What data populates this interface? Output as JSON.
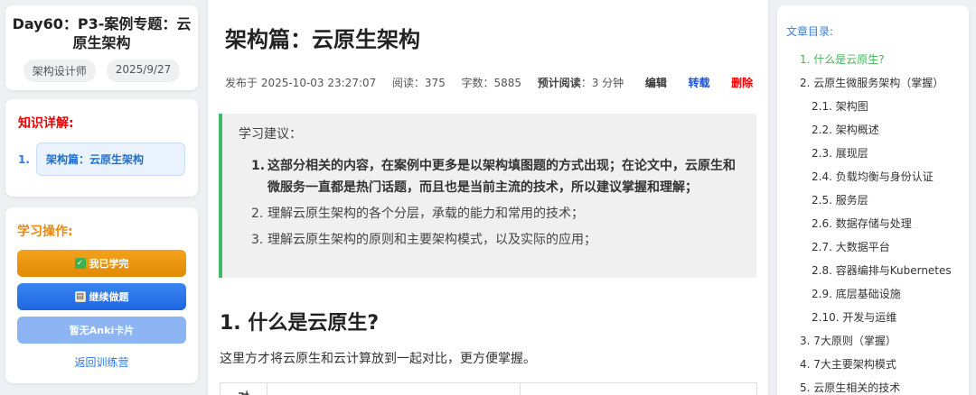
{
  "course": {
    "title": "Day60：P3-案例专题：云原生架构",
    "tags": [
      "架构设计师",
      "2025/9/27"
    ]
  },
  "knowledge": {
    "label": "知识详解:",
    "items": [
      {
        "num": "1.",
        "label": "架构篇：云原生架构"
      }
    ]
  },
  "study": {
    "label": "学习操作:",
    "done_button": "我已学完",
    "done_icon": "check-box-icon",
    "continue_button": "继续做题",
    "continue_icon": "clipboard-icon",
    "anki_button": "暂无Anki卡片",
    "back_link": "返回训练营"
  },
  "article": {
    "title": "架构篇：云原生架构",
    "meta": {
      "published": "发布于 2025-10-03 23:27:07",
      "reads": "阅读：375",
      "words": "字数：5885",
      "est_label": "预计阅读",
      "est_value": "：3 分钟",
      "edit": "编辑",
      "repost": "转载",
      "delete": "删除"
    },
    "advice": {
      "title": "学习建议：",
      "items": [
        {
          "num": "1.",
          "text": "这部分相关的内容，在案例中更多是以架构填图题的方式出现；在论文中，云原生和微服务一直都是热门话题，而且也是当前主流的技术，所以建议掌握和理解；",
          "bold": true
        },
        {
          "num": "2.",
          "text": "理解云原生架构的各个分层，承载的能力和常用的技术；",
          "bold": false
        },
        {
          "num": "3.",
          "text": "理解云原生架构的原则和主要架构模式，以及实际的应用；",
          "bold": false
        }
      ]
    },
    "section_heading": "1. 什么是云原生?",
    "section_text": "这里方才将云原生和云计算放到一起对比，更方便掌握。",
    "table_first_cell": "对"
  },
  "toc": {
    "title": "文章目录:",
    "items": [
      {
        "label": "1. 什么是云原生?",
        "level": 1,
        "active": true
      },
      {
        "label": "2. 云原生微服务架构（掌握）",
        "level": 1,
        "active": false
      },
      {
        "label": "2.1. 架构图",
        "level": 2,
        "active": false
      },
      {
        "label": "2.2. 架构概述",
        "level": 2,
        "active": false
      },
      {
        "label": "2.3. 展现层",
        "level": 2,
        "active": false
      },
      {
        "label": "2.4. 负载均衡与身份认证",
        "level": 2,
        "active": false
      },
      {
        "label": "2.5. 服务层",
        "level": 2,
        "active": false
      },
      {
        "label": "2.6. 数据存储与处理",
        "level": 2,
        "active": false
      },
      {
        "label": "2.7. 大数据平台",
        "level": 2,
        "active": false
      },
      {
        "label": "2.8. 容器编排与Kubernetes",
        "level": 2,
        "active": false
      },
      {
        "label": "2.9. 底层基础设施",
        "level": 2,
        "active": false
      },
      {
        "label": "2.10. 开发与运维",
        "level": 2,
        "active": false
      },
      {
        "label": "3. 7大原则（掌握）",
        "level": 1,
        "active": false
      },
      {
        "label": "4. 7大主要架构模式",
        "level": 1,
        "active": false
      },
      {
        "label": "5. 云原生相关的技术",
        "level": 1,
        "active": false
      }
    ]
  }
}
